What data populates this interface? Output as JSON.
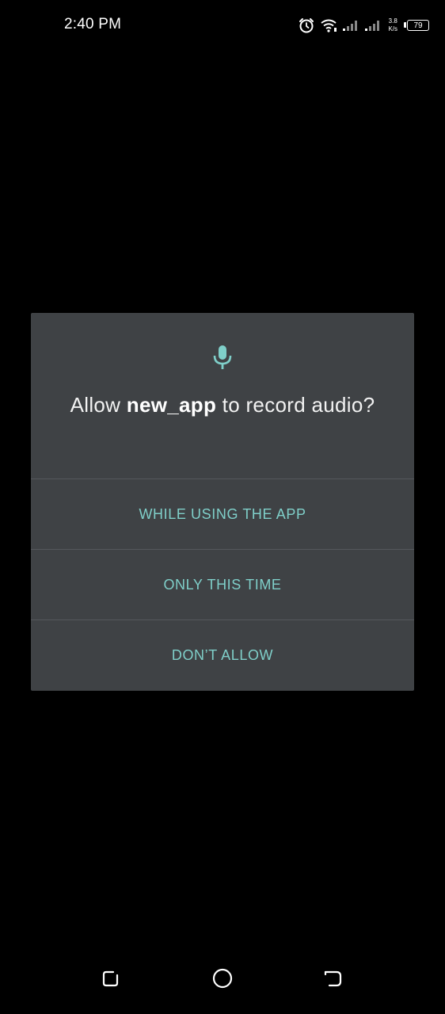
{
  "status_bar": {
    "time": "2:40 PM",
    "net_speed_value": "3.8",
    "net_speed_unit": "K/s",
    "battery_level": "79",
    "icons": [
      "alarm-icon",
      "wifi-icon",
      "signal-icon",
      "signal-icon",
      "battery-icon"
    ]
  },
  "dialog": {
    "icon": "microphone-icon",
    "message_prefix": "Allow ",
    "app_name": "new_app",
    "message_suffix": " to record audio?",
    "options": [
      {
        "label": "WHILE USING THE APP"
      },
      {
        "label": "ONLY THIS TIME"
      },
      {
        "label": "DON’T ALLOW"
      }
    ],
    "accent_color": "#7fcfc9",
    "background_color": "#3f4245"
  },
  "nav_bar": {
    "icons": [
      "recents-icon",
      "home-icon",
      "back-icon"
    ]
  }
}
